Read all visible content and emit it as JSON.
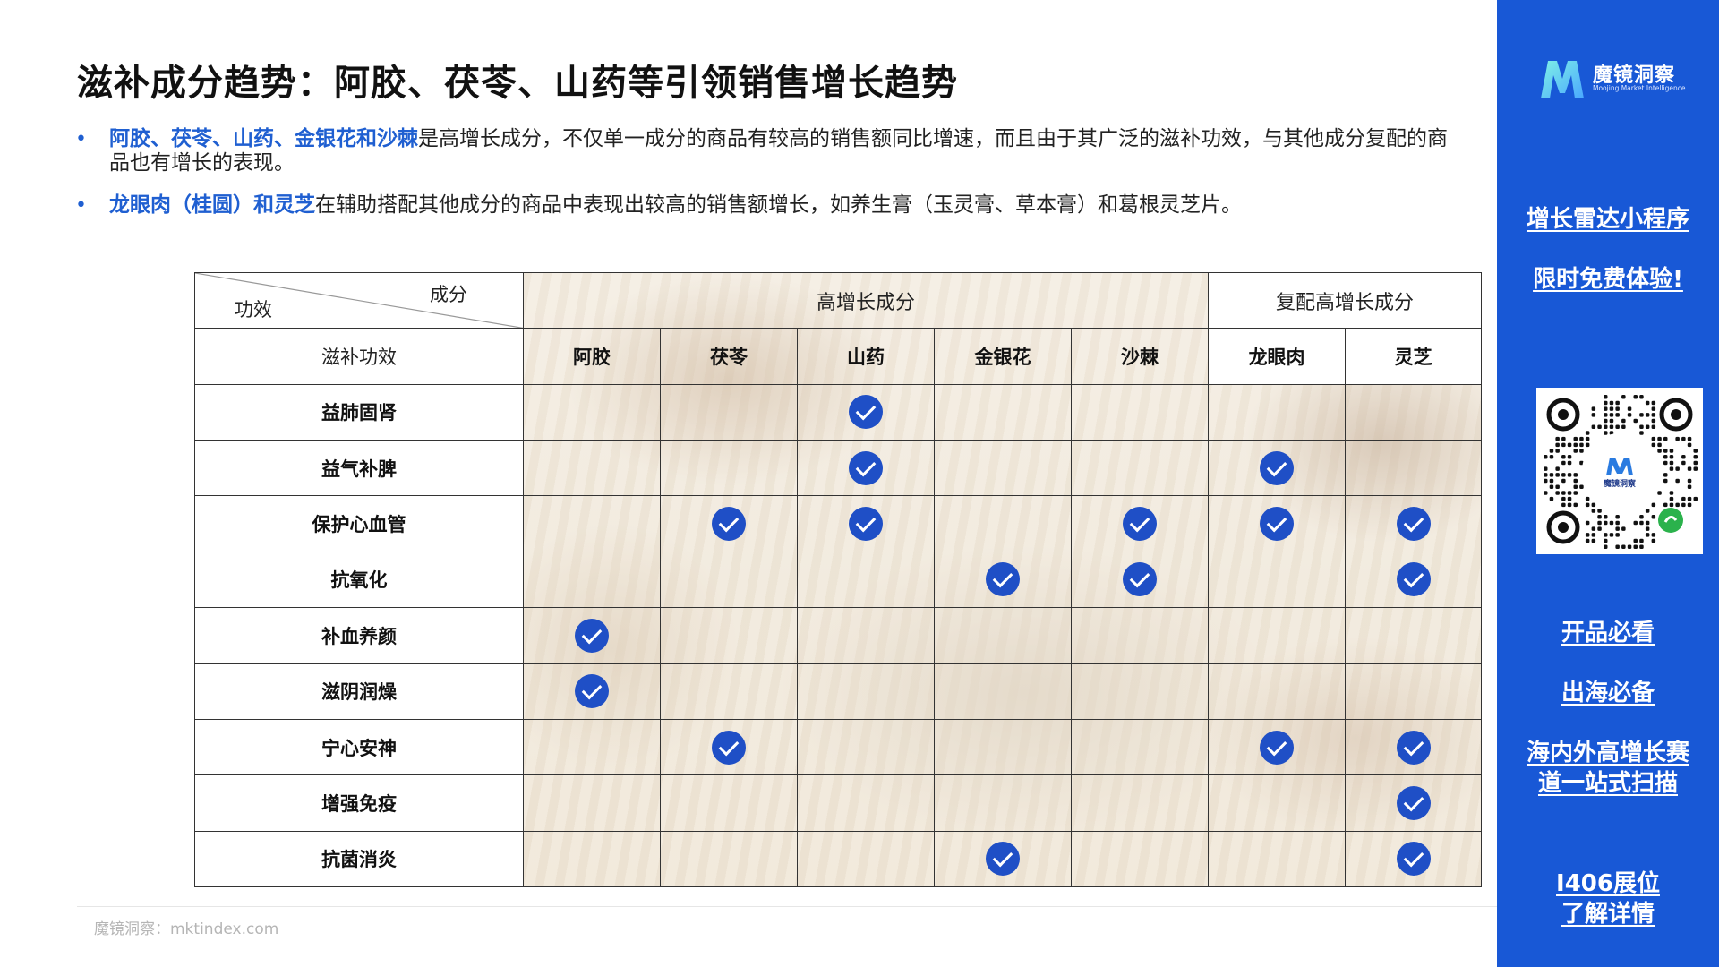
{
  "title": "滋补成分趋势：阿胶、茯苓、山药等引领销售增长趋势",
  "bullets": [
    {
      "highlight": "阿胶、茯苓、山药、金银花和沙棘",
      "text": "是高增长成分，不仅单一成分的商品有较高的销售额同比增速，而且由于其广泛的滋补功效，与其他成分复配的商品也有增长的表现。"
    },
    {
      "highlight": "龙眼肉（桂圆）和灵芝",
      "text": "在辅助搭配其他成分的商品中表现出较高的销售额增长，如养生膏（玉灵膏、草本膏）和葛根灵芝片。"
    }
  ],
  "table": {
    "corner_top": "成分",
    "corner_bottom": "功效",
    "group_high": "高增长成分",
    "group_combo": "复配高增长成分",
    "subheader": "滋补功效",
    "columns": [
      "阿胶",
      "茯苓",
      "山药",
      "金银花",
      "沙棘",
      "龙眼肉",
      "灵芝"
    ],
    "rows": [
      {
        "label": "益肺固肾",
        "checks": [
          false,
          false,
          true,
          false,
          false,
          false,
          false
        ]
      },
      {
        "label": "益气补脾",
        "checks": [
          false,
          false,
          true,
          false,
          false,
          true,
          false
        ]
      },
      {
        "label": "保护心血管",
        "checks": [
          false,
          true,
          true,
          false,
          true,
          true,
          true
        ]
      },
      {
        "label": "抗氧化",
        "checks": [
          false,
          false,
          false,
          true,
          true,
          false,
          true
        ]
      },
      {
        "label": "补血养颜",
        "checks": [
          true,
          false,
          false,
          false,
          false,
          false,
          false
        ]
      },
      {
        "label": "滋阴润燥",
        "checks": [
          true,
          false,
          false,
          false,
          false,
          false,
          false
        ]
      },
      {
        "label": "宁心安神",
        "checks": [
          false,
          true,
          false,
          false,
          false,
          true,
          true
        ]
      },
      {
        "label": "增强免疫",
        "checks": [
          false,
          false,
          false,
          false,
          false,
          false,
          true
        ]
      },
      {
        "label": "抗菌消炎",
        "checks": [
          false,
          false,
          false,
          true,
          false,
          false,
          true
        ]
      }
    ]
  },
  "footer": "魔镜洞察：mktindex.com",
  "sidebar": {
    "logo_name": "魔镜洞察",
    "logo_sub": "Moojing Market Intelligence",
    "qr_label": "魔镜洞察",
    "links": [
      "增长雷达小程序",
      "限时免费体验!",
      "开品必看",
      "出海必备",
      "海内外高增长赛",
      "道一站式扫描",
      "I406展位",
      "了解详情"
    ],
    "accent": "#1858d6"
  },
  "colors": {
    "highlight": "#1f5fd1",
    "check": "#1f4fc6"
  }
}
